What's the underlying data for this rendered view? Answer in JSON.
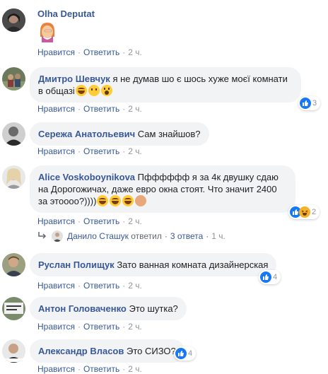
{
  "comments": [
    {
      "author": "Olha Deputat",
      "text": "",
      "has_sticker": true,
      "like": "Нравится",
      "reply": "Ответить",
      "time": "2 ч.",
      "reactions": null
    },
    {
      "author": "Дмитро Шевчук",
      "text": "я не думав шо є шось хуже моєї комнати в общазі",
      "like": "Нравится",
      "reply": "Ответить",
      "time": "2 ч.",
      "reactions": {
        "count": "3",
        "icons": [
          "like-icon"
        ]
      }
    },
    {
      "author": "Сережа Анатольевич",
      "text": "Сам знайшов?",
      "like": "Нравится",
      "reply": "Ответить",
      "time": "2 ч.",
      "reactions": null
    },
    {
      "author": "Alice Voskoboynikova",
      "text": "Пфффффф я за 4к двушку сдаю на Дорогожичах, даже евро окна стоят. Что значит 2400 за этоооо?))))",
      "like": "Нравится",
      "reply": "Ответить",
      "time": "2 ч.",
      "reactions": {
        "count": "2",
        "icons": [
          "like-icon",
          "haha-icon"
        ]
      },
      "replies": {
        "name": "Данило Сташук",
        "verb": "ответил",
        "count": "3 ответа",
        "time": "1 ч."
      }
    },
    {
      "author": "Руслан Полищук",
      "text": "Зато ванная комната дизайнерская",
      "like": "Нравится",
      "reply": "Ответить",
      "time": "2 ч.",
      "reactions": {
        "count": "4",
        "icons": [
          "like-icon"
        ]
      }
    },
    {
      "author": "Антон Головаченко",
      "text": "Это шутка?",
      "like": "Нравится",
      "reply": "Ответить",
      "time": "2 ч.",
      "reactions": null
    },
    {
      "author": "Александр Власов",
      "text": "Это СИЗО?",
      "like": "Нравится",
      "reply": "Ответить",
      "time": "2 ч.",
      "reactions": {
        "count": "4",
        "icons": [
          "like-icon"
        ]
      }
    }
  ],
  "colors": {
    "author": "#385898",
    "bubble": "#f2f3f5",
    "meta": "#90949c",
    "like": "#1877f2",
    "haha": "#f7b125"
  }
}
